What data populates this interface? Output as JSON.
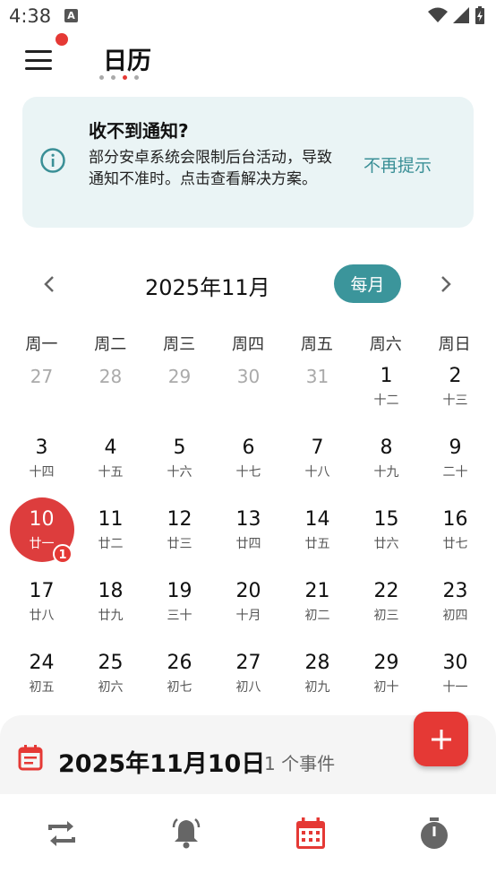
{
  "status": {
    "time": "4:38",
    "a_label": "A"
  },
  "header": {
    "title": "日历"
  },
  "notice": {
    "title": "收不到通知?",
    "body": "部分安卓系统会限制后台活动，导致通知不准时。点击查看解决方案。",
    "dismiss": "不再提示"
  },
  "calendar": {
    "month_label": "2025年11月",
    "view_button": "每月",
    "weekdays": [
      "周一",
      "周二",
      "周三",
      "周四",
      "周五",
      "周六",
      "周日"
    ],
    "days": [
      {
        "n": "27",
        "l": "",
        "other": true
      },
      {
        "n": "28",
        "l": "",
        "other": true
      },
      {
        "n": "29",
        "l": "",
        "other": true
      },
      {
        "n": "30",
        "l": "",
        "other": true
      },
      {
        "n": "31",
        "l": "",
        "other": true
      },
      {
        "n": "1",
        "l": "十二"
      },
      {
        "n": "2",
        "l": "十三"
      },
      {
        "n": "3",
        "l": "十四"
      },
      {
        "n": "4",
        "l": "十五"
      },
      {
        "n": "5",
        "l": "十六"
      },
      {
        "n": "6",
        "l": "十七"
      },
      {
        "n": "7",
        "l": "十八"
      },
      {
        "n": "8",
        "l": "十九"
      },
      {
        "n": "9",
        "l": "二十"
      },
      {
        "n": "10",
        "l": "廿一",
        "today": true
      },
      {
        "n": "11",
        "l": "廿二"
      },
      {
        "n": "12",
        "l": "廿三"
      },
      {
        "n": "13",
        "l": "廿四"
      },
      {
        "n": "14",
        "l": "廿五"
      },
      {
        "n": "15",
        "l": "廿六"
      },
      {
        "n": "16",
        "l": "廿七"
      },
      {
        "n": "17",
        "l": "廿八"
      },
      {
        "n": "18",
        "l": "廿九"
      },
      {
        "n": "19",
        "l": "三十"
      },
      {
        "n": "20",
        "l": "十月"
      },
      {
        "n": "21",
        "l": "初二"
      },
      {
        "n": "22",
        "l": "初三"
      },
      {
        "n": "23",
        "l": "初四"
      },
      {
        "n": "24",
        "l": "初五"
      },
      {
        "n": "25",
        "l": "初六"
      },
      {
        "n": "26",
        "l": "初七"
      },
      {
        "n": "27",
        "l": "初八"
      },
      {
        "n": "28",
        "l": "初九"
      },
      {
        "n": "29",
        "l": "初十"
      },
      {
        "n": "30",
        "l": "十一"
      }
    ],
    "today_badge": "1"
  },
  "sheet": {
    "date": "2025年11月10日",
    "count": "1 个事件"
  },
  "bottom_nav": [
    "repeat-icon",
    "bell-icon",
    "calendar-icon",
    "timer-icon"
  ],
  "colors": {
    "accent": "#e53935",
    "teal": "#3b959b",
    "notice_bg": "#eaf4f5"
  }
}
